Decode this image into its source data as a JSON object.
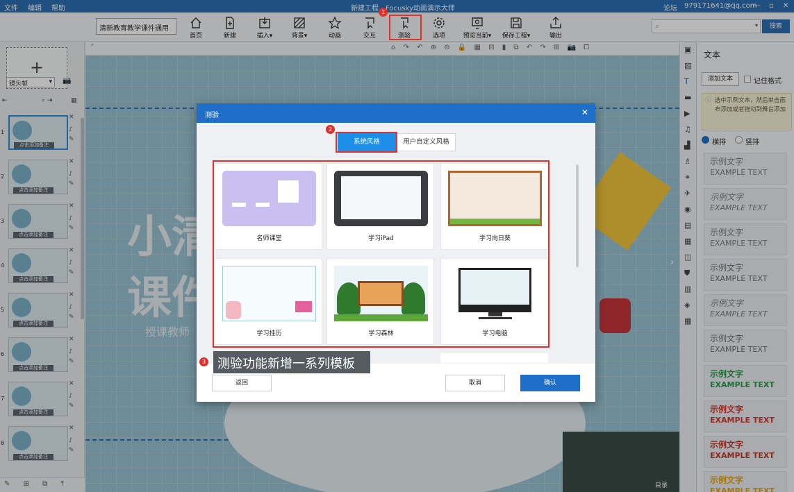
{
  "titlebar": {
    "menus": [
      "文件",
      "编辑",
      "帮助"
    ],
    "title": "新建工程 - Focusky动画演示大师",
    "forum": "论坛",
    "account": "979171641@qq.com",
    "window_controls": [
      "—",
      "▫",
      "✕"
    ]
  },
  "toolbar": {
    "project_name": "清新教育教学课件通用",
    "buttons": [
      "首页",
      "新建",
      "插入",
      "背景",
      "动画",
      "交互",
      "测验",
      "选项",
      "预览当前",
      "保存工程",
      "输出"
    ],
    "search_placeholder": "",
    "search_button": "搜索"
  },
  "left_pane": {
    "camera_frame_label": "镜头帧",
    "thumb_caption": "点击添加备注",
    "thumb_numbers": [
      "1",
      "2",
      "3",
      "4",
      "5",
      "6",
      "7",
      "8"
    ]
  },
  "canvas": {
    "big_text_1": "小清",
    "big_text_2": "课件",
    "sub_text": "授课教师",
    "toc_label": "目录"
  },
  "right_pane": {
    "heading": "文本",
    "add_text_button": "添加文本",
    "remember_format_label": "记住格式",
    "tip": "选中示例文本，然后单击画布添加或者拖动到舞台添加",
    "orientation_h": "横排",
    "orientation_v": "竖排",
    "samples": [
      {
        "cn": "示例文字",
        "en": "EXAMPLE TEXT",
        "color": "#7b8086"
      },
      {
        "cn": "示例文字",
        "en": "EXAMPLE TEXT",
        "color": "#7b8086"
      },
      {
        "cn": "示例文字",
        "en": "EXAMPLE TEXT",
        "color": "#7b8086"
      },
      {
        "cn": "示例文字",
        "en": "EXAMPLE TEXT",
        "color": "#6b7076"
      },
      {
        "cn": "示例文字",
        "en": "EXAMPLE TEXT",
        "color": "#7b8086"
      },
      {
        "cn": "示例文字",
        "en": "EXAMPLE TEXT",
        "color": "#6b7076"
      },
      {
        "cn": "示例文字",
        "en": "EXAMPLE TEXT",
        "color": "#2e9a52"
      },
      {
        "cn": "示例文字",
        "en": "EXAMPLE TEXT",
        "color": "#d23a2f"
      },
      {
        "cn": "示例文字",
        "en": "EXAMPLE TEXT",
        "color": "#c0392b"
      },
      {
        "cn": "示例文字",
        "en": "EXAMPLE TEXT",
        "color": "#e2a416"
      }
    ]
  },
  "dialog": {
    "title": "测验",
    "close": "✕",
    "tabs": [
      "系统风格",
      "用户自定义风格"
    ],
    "templates": [
      "名师课堂",
      "学习iPad",
      "学习向日葵",
      "学习挂历",
      "学习森林",
      "学习电脑"
    ],
    "back_button": "返回",
    "cancel_button": "取消",
    "confirm_button": "确认"
  },
  "annotations": {
    "badges": [
      "1",
      "2",
      "3"
    ],
    "callout_text": "测验功能新增一系列模板",
    "callout_color": "#e0312b"
  },
  "colors": {
    "accent": "#1f6fc8",
    "titlebar": "#2d6fb3",
    "active_tab": "#1e8fe8"
  }
}
